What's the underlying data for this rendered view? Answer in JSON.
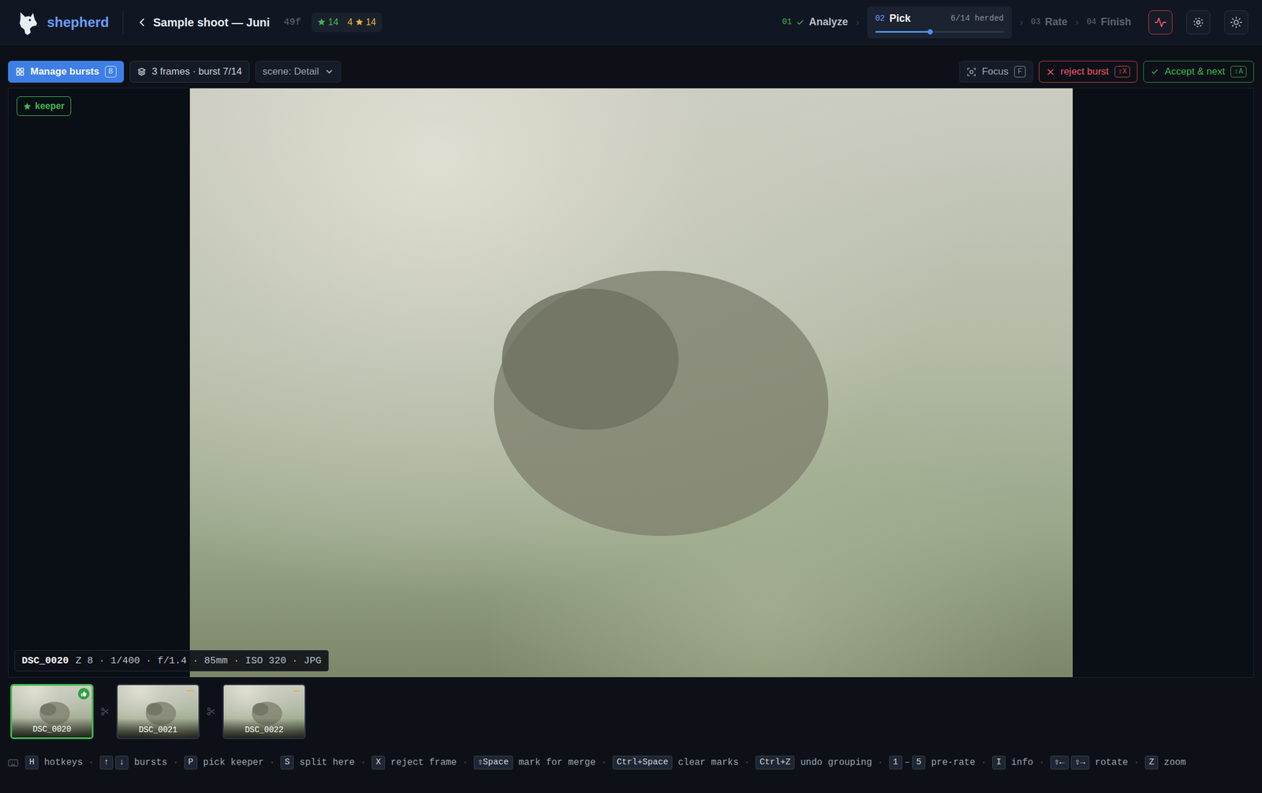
{
  "app": {
    "name": "shepherd"
  },
  "project": {
    "title": "Sample shoot — Juni",
    "frames": "49f",
    "keepers": "14",
    "rated": "4",
    "rated_total": "14"
  },
  "steps_separator": "›",
  "steps": [
    {
      "number": "01",
      "label": "Analyze",
      "done": true,
      "selected": false
    },
    {
      "number": "02",
      "label": "Pick",
      "done": false,
      "selected": true,
      "progress": "6/14 herded",
      "level": 0.43
    },
    {
      "number": "03",
      "label": "Rate",
      "done": false,
      "selected": false
    },
    {
      "number": "04",
      "label": "Finish",
      "done": false,
      "selected": false
    }
  ],
  "toolbar": {
    "manage_bursts": {
      "label": "Manage bursts",
      "key": "B",
      "selected": true
    },
    "burst_info": "3 frames · burst 7/14",
    "scene": "scene: Detail",
    "focus": {
      "label": "Focus",
      "key": "F"
    },
    "reject": {
      "label": "reject burst",
      "key": "⇧X"
    },
    "accept": {
      "label": "Accept & next",
      "key": "⇧A"
    }
  },
  "viewer": {
    "badge": "keeper",
    "file": "DSC_0020",
    "meta": "Z 8 · 1/400 · f/1.4 · 85mm · ISO 320 · JPG"
  },
  "frames": [
    {
      "name": "DSC_0020",
      "selected": true,
      "kind": "keeper"
    },
    {
      "name": "DSC_0021",
      "selected": false,
      "kind": "pending"
    },
    {
      "name": "DSC_0022",
      "selected": false,
      "kind": "pending"
    }
  ],
  "hotkeys_separator": "·",
  "hotkeys": [
    {
      "keys": [
        "H"
      ],
      "label": "hotkeys"
    },
    {
      "keys": [
        "↑",
        "↓"
      ],
      "label": "bursts"
    },
    {
      "keys": [
        "P"
      ],
      "label": "pick keeper"
    },
    {
      "keys": [
        "S"
      ],
      "label": "split here"
    },
    {
      "keys": [
        "X"
      ],
      "label": "reject frame"
    },
    {
      "keys": [
        "⇧Space"
      ],
      "label": "mark for merge"
    },
    {
      "keys": [
        "Ctrl+Space"
      ],
      "label": "clear marks"
    },
    {
      "keys": [
        "Ctrl+Z"
      ],
      "label": "undo grouping"
    },
    {
      "keys": [
        "1",
        "5"
      ],
      "joiner": "–",
      "label": "pre-rate"
    },
    {
      "keys": [
        "I"
      ],
      "label": "info"
    },
    {
      "keys": [
        "⇧←",
        "⇧→"
      ],
      "label": "rotate"
    },
    {
      "keys": [
        "Z"
      ],
      "label": "zoom"
    }
  ]
}
